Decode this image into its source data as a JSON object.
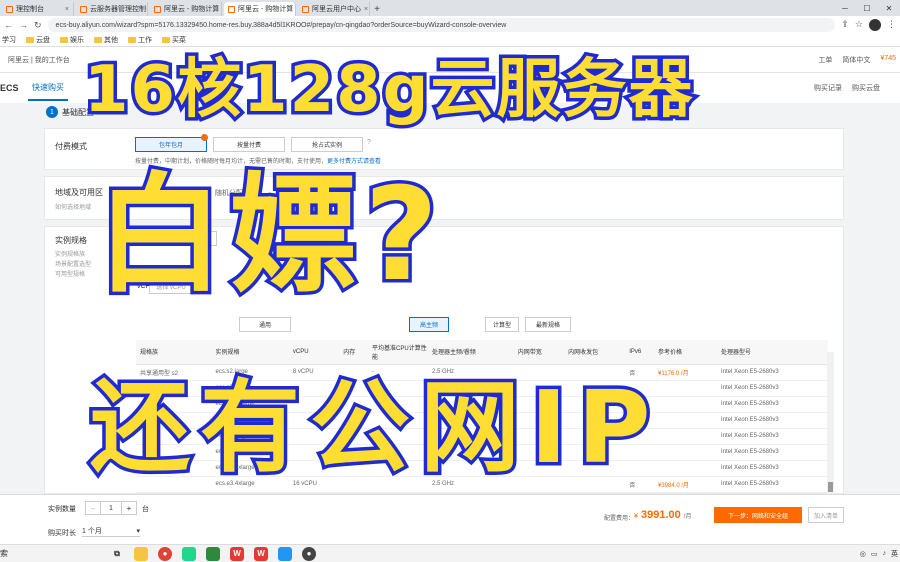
{
  "browser": {
    "tabs": [
      {
        "label": "理控制台",
        "active": false
      },
      {
        "label": "云服务器管理控制台",
        "active": false
      },
      {
        "label": "阿里云 - 购物计算",
        "active": false
      },
      {
        "label": "阿里云 - 购物计算",
        "active": true
      },
      {
        "label": "阿里云用户中心",
        "active": false
      }
    ],
    "new_tab": "+",
    "url": "ecs-buy.aliyun.com/wizard?spm=5176.13329450.home-res.buy.388a4d5l1KROO#/prepay/cn-qingdao?orderSource=buyWizard-console-overview",
    "bookmarks": [
      "学习",
      "云盘",
      "娱乐",
      "其他",
      "工作",
      "买菜"
    ]
  },
  "console": {
    "brand": "阿里云 | 我的工作台",
    "right_items": [
      "工单",
      "简体中文"
    ],
    "top_price": "¥745",
    "ecs": "ECS",
    "quick_tab": "快速购买",
    "right_links": [
      "购买记录",
      "购买云盘"
    ]
  },
  "step": {
    "num": "1",
    "label": "基础配置"
  },
  "billing": {
    "label": "付费模式",
    "options": [
      "包年包月",
      "按量付费",
      "抢占式实例"
    ],
    "hint": "按量付费，中期计划，价格随时每月均计，无需已售的时期，支付使用",
    "hint_link": "更多付费方式请查看"
  },
  "region": {
    "label": "地域及可用区",
    "sub": "如何选择地域",
    "value": "随机分配"
  },
  "instance": {
    "label": "实例规格",
    "subs": [
      "实例规格族",
      "场景配置选型",
      "可用型规格"
    ],
    "tabs": [
      "分类选择",
      "场景"
    ],
    "vcpu_label": "vCPU",
    "vcpu_placeholder": "选择 vCPU",
    "arch_btns": [
      "通用",
      "高主频",
      "计算型",
      "最新规格"
    ]
  },
  "table": {
    "headers": [
      "规格族",
      "实例规格",
      "vCPU",
      "内存",
      "平均基准CPU计算性能",
      "处理器主频/睿频",
      "内网带宽",
      "内网收发包",
      "IPv6",
      "参考价格",
      "处理器型号"
    ],
    "rows": [
      [
        "共享通用型 s2",
        "ecs.s2.large",
        "8 vCPU",
        "",
        "-",
        "2.5 GHz",
        "",
        "",
        "否",
        "¥1176.0 /月",
        "Intel Xeon E5-2680v3"
      ],
      [
        "",
        "ecs.n2.xlarge",
        "",
        "",
        "",
        "",
        "",
        "",
        "",
        "",
        "Intel Xeon E5-2680v3"
      ],
      [
        "",
        "ecs.n2.2xlarge",
        "",
        "",
        "",
        "",
        "",
        "",
        "",
        "",
        "Intel Xeon E5-2680v3"
      ],
      [
        "",
        "ecs.e3.small",
        "",
        "",
        "",
        "",
        "",
        "",
        "",
        "",
        "Intel Xeon E5-2680v3"
      ],
      [
        "",
        "ecs.e3.large",
        "",
        "",
        "",
        "",
        "",
        "",
        "",
        "",
        "Intel Xeon E5-2680v3"
      ],
      [
        "",
        "ecs.e3.xlarge",
        "",
        "",
        "",
        "",
        "",
        "",
        "",
        "",
        "Intel Xeon E5-2680v3"
      ],
      [
        "",
        "ecs.e3.2xlarge",
        "",
        "",
        "",
        "",
        "",
        "",
        "",
        "",
        "Intel Xeon E5-2680v3"
      ],
      [
        "",
        "ecs.e3.4xlarge",
        "16 vCPU",
        "",
        "",
        "2.5 GHz",
        "",
        "",
        "否",
        "¥3984.0 /月",
        "Intel Xeon E5-2680v3"
      ]
    ]
  },
  "bottom": {
    "qty_label": "实例数量",
    "qty_minus": "−",
    "qty_value": "1",
    "qty_plus": "+",
    "qty_unit": "台",
    "duration_label": "购买时长",
    "duration_value": "1 个月",
    "fee_label": "配置费用：",
    "fee_currency": "¥",
    "fee_value": "3991.00",
    "fee_unit": "/月",
    "next_button": "下一步：网络和安全组",
    "add_button": "加入清单"
  },
  "taskbar": {
    "search": "索"
  },
  "overlay": {
    "line1": "16核128g云服务器",
    "line2": "白嫖?",
    "line3": "还有公网IP"
  },
  "colors": {
    "overlay_fill": "#ffdd33",
    "overlay_stroke": "#1f2bd0",
    "aliyun_orange": "#ff6a00",
    "link_blue": "#0070cc"
  }
}
